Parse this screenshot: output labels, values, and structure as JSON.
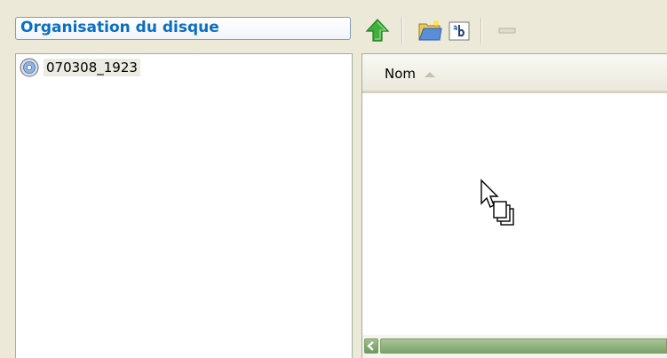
{
  "panel": {
    "title": "Organisation du disque"
  },
  "toolbar": {
    "buttons": [
      {
        "icon": "up-arrow-icon"
      },
      {
        "icon": "new-folder-icon"
      },
      {
        "icon": "rename-icon"
      },
      {
        "icon": "delete-icon",
        "enabled": false
      }
    ]
  },
  "tree": {
    "items": [
      {
        "label": "070308_1923",
        "icon": "disc-icon",
        "selected": true
      }
    ]
  },
  "list": {
    "columns": [
      {
        "label": "Nom",
        "sort": "ascending"
      }
    ],
    "rows": []
  },
  "colors": {
    "title_text": "#0a6fc2",
    "pane_border": "#9eb29a",
    "scrollbar": "#7ba36a",
    "window_bg": "#ece9d8"
  }
}
